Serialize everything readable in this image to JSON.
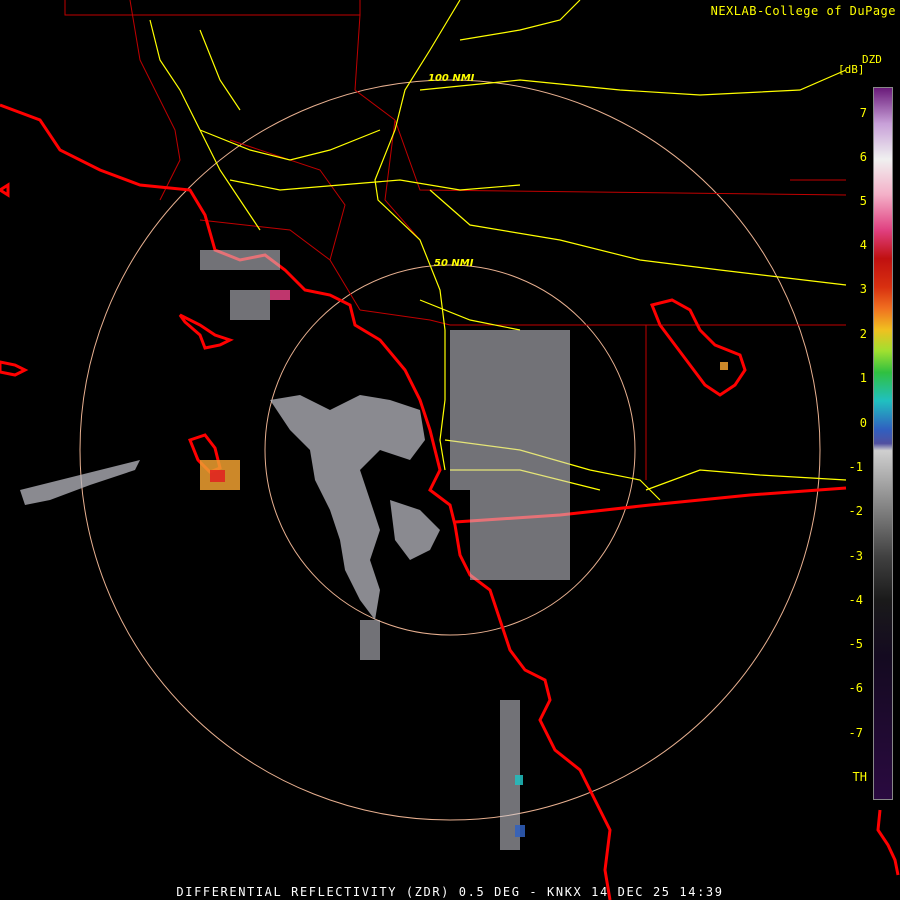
{
  "credit": "NEXLAB-College of DuPage",
  "product_code": "DZD",
  "unit": "[dB]",
  "range_rings": [
    "100 NMI",
    "50 NMI"
  ],
  "legend_ticks": [
    "7",
    "6",
    "5",
    "4",
    "3",
    "2",
    "1",
    "0",
    "-1",
    "-2",
    "-3",
    "-4",
    "-5",
    "-6",
    "-7",
    "TH"
  ],
  "footer": "DIFFERENTIAL REFLECTIVITY (ZDR) 0.5 DEG - KNKX 14 DEC 25 14:39",
  "colors": {
    "text": "#ffff00",
    "ring": "#e8b090",
    "border": "#ff0000",
    "roads": "#ffff00",
    "echo_gray": "#b8b8c0"
  },
  "map_features": [
    "coastline-border",
    "county-lines",
    "highways",
    "range-rings",
    "radar-echoes"
  ]
}
